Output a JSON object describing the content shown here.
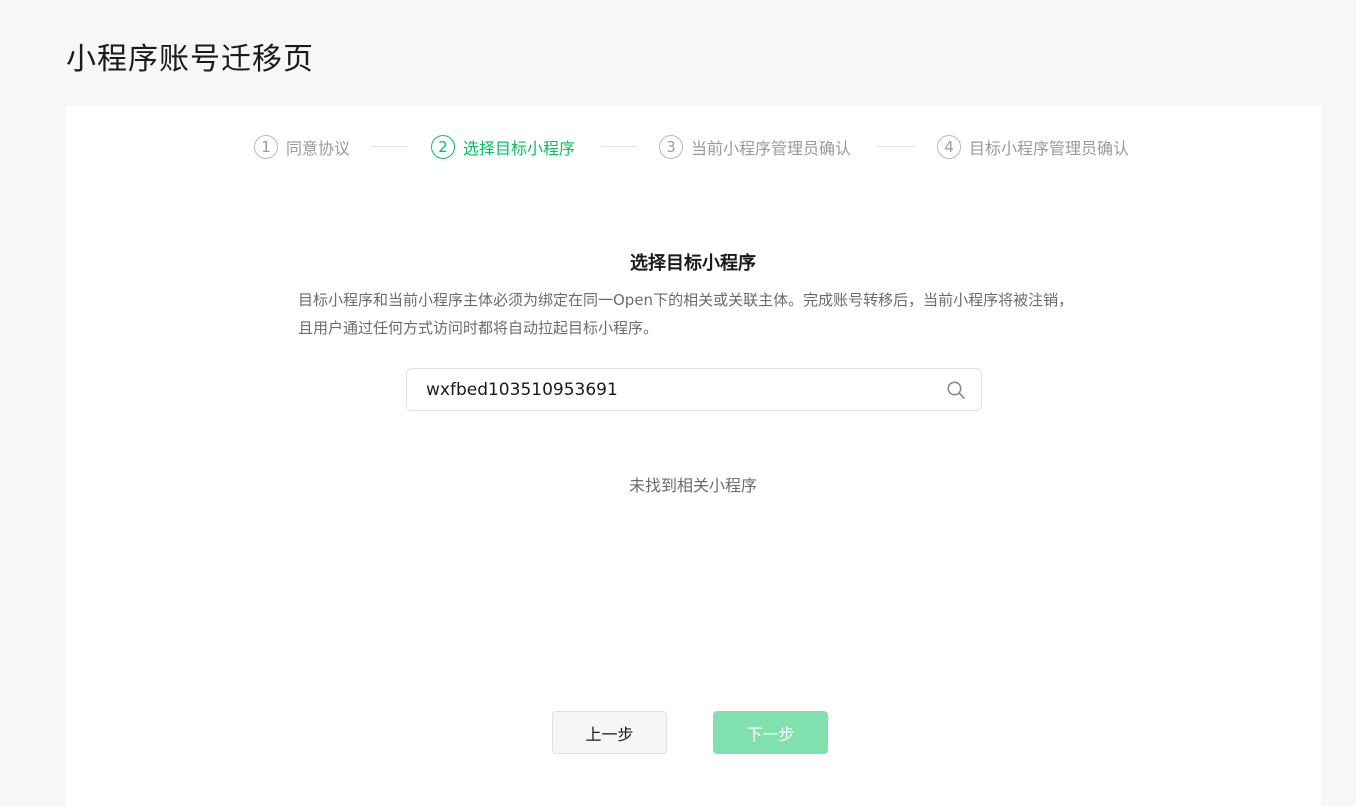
{
  "page": {
    "title": "小程序账号迁移页"
  },
  "steps": [
    {
      "number": "1",
      "label": "同意协议",
      "state": "inactive"
    },
    {
      "number": "2",
      "label": "选择目标小程序",
      "state": "active"
    },
    {
      "number": "3",
      "label": "当前小程序管理员确认",
      "state": "inactive"
    },
    {
      "number": "4",
      "label": "目标小程序管理员确认",
      "state": "inactive"
    }
  ],
  "section": {
    "title": "选择目标小程序",
    "description": "目标小程序和当前小程序主体必须为绑定在同一Open下的相关或关联主体。完成账号转移后，当前小程序将被注销，且用户通过任何方式访问时都将自动拉起目标小程序。"
  },
  "search": {
    "value": "wxfbed103510953691",
    "icon": "search-icon"
  },
  "result": {
    "empty_text": "未找到相关小程序"
  },
  "buttons": {
    "prev_label": "上一步",
    "next_label": "下一步"
  },
  "colors": {
    "accent": "#07c160",
    "accent_disabled": "#80e0ae",
    "background": "#f6f7f9"
  }
}
